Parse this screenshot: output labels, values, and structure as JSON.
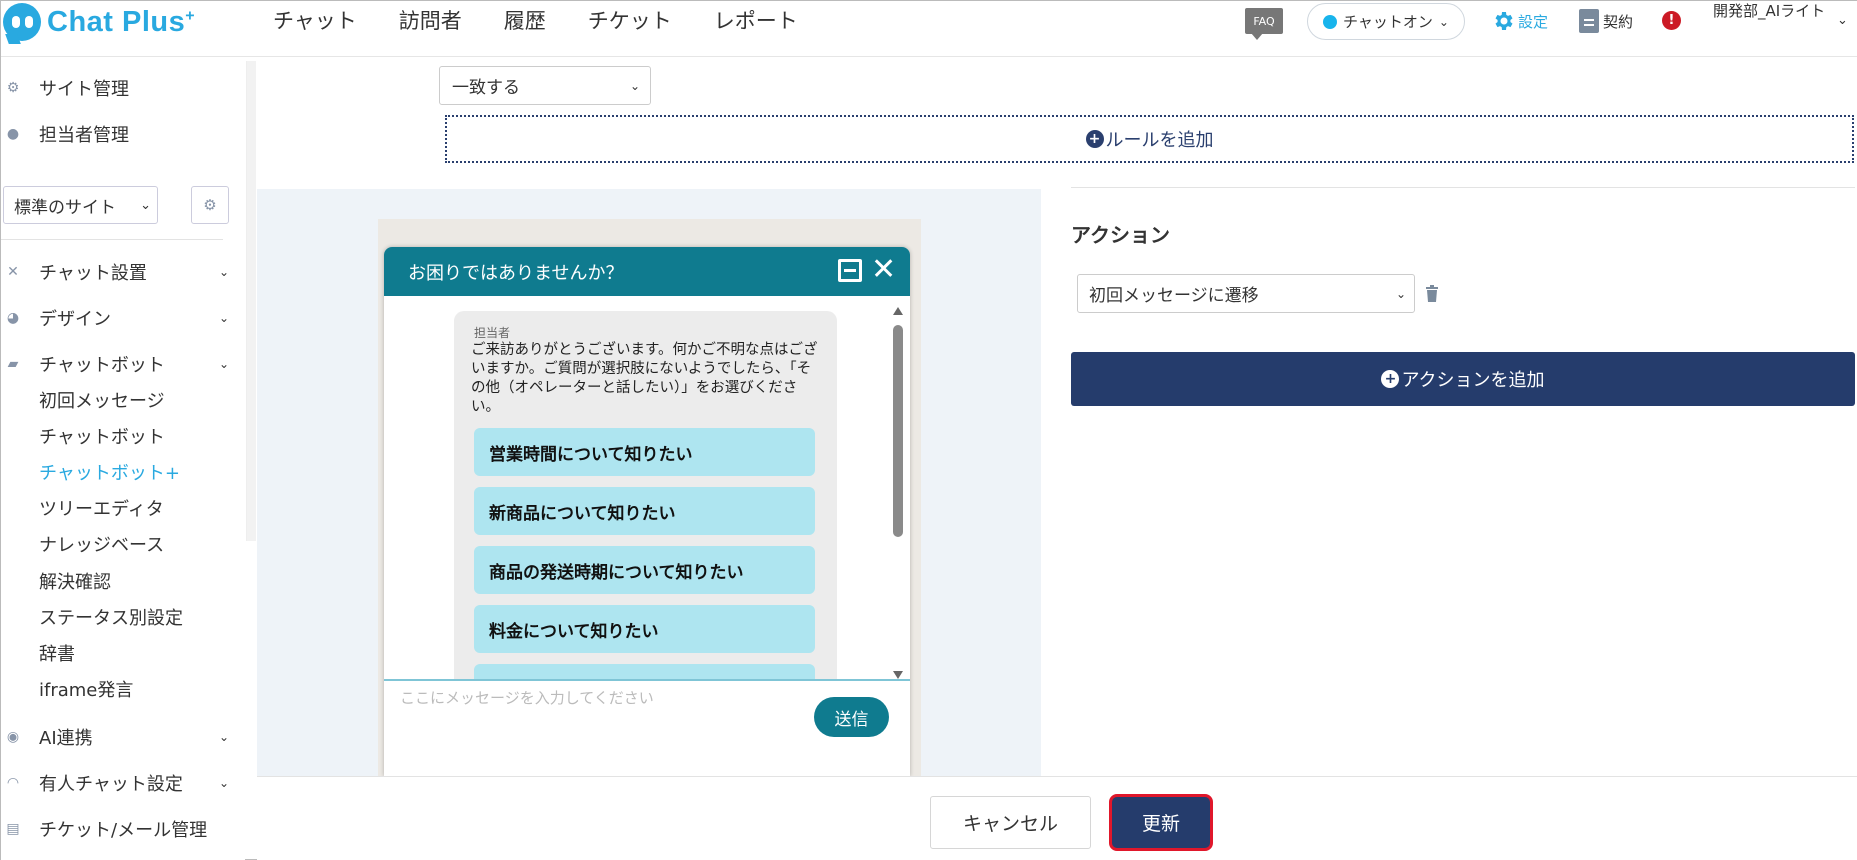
{
  "header": {
    "logo_text": "Chat Plus",
    "logo_sup": "+",
    "nav": [
      "チャット",
      "訪問者",
      "履歴",
      "チケット",
      "レポート"
    ],
    "faq": "FAQ",
    "chat_status": "チャットオン",
    "settings": "設定",
    "contract": "契約",
    "alert": "!",
    "user": "開発部_AIライト"
  },
  "sidebar": {
    "site_admin": "サイト管理",
    "staff_admin": "担当者管理",
    "site_select": "標準のサイト",
    "items": [
      {
        "label": "チャット設置"
      },
      {
        "label": "デザイン"
      },
      {
        "label": "チャットボット"
      }
    ],
    "sub_items": [
      "初回メッセージ",
      "チャットボット",
      "チャットボット+",
      "ツリーエディタ",
      "ナレッジベース",
      "解決確認",
      "ステータス別設定",
      "辞書",
      "iframe発言"
    ],
    "lower_items": [
      {
        "label": "AI連携"
      },
      {
        "label": "有人チャット設定"
      },
      {
        "label": "チケット/メール管理"
      }
    ]
  },
  "rule": {
    "match_select": "一致する",
    "add_rule": "ルールを追加"
  },
  "action": {
    "title": "アクション",
    "select": "初回メッセージに遷移",
    "add_action": "アクションを追加"
  },
  "widget": {
    "title": "お困りではありませんか？",
    "sender": "担当者",
    "message": "ご来訪ありがとうございます。何かご不明な点はございますか。ご質問が選択肢にないようでしたら、「その他（オペレーターと話したい）」をお選びください。",
    "options": [
      "営業時間について知りたい",
      "新商品について知りたい",
      "商品の発送時期について知りたい",
      "料金について知りたい"
    ],
    "input_placeholder": "ここにメッセージを入力してください",
    "send": "送信"
  },
  "footer": {
    "cancel": "キャンセル",
    "update": "更新"
  },
  "colors": {
    "brand": "#29a9e0",
    "navy": "#253c6c",
    "widget_teal": "#0f7b8f",
    "option_bg": "#aee5f0",
    "highlight_border": "#e0172b"
  }
}
